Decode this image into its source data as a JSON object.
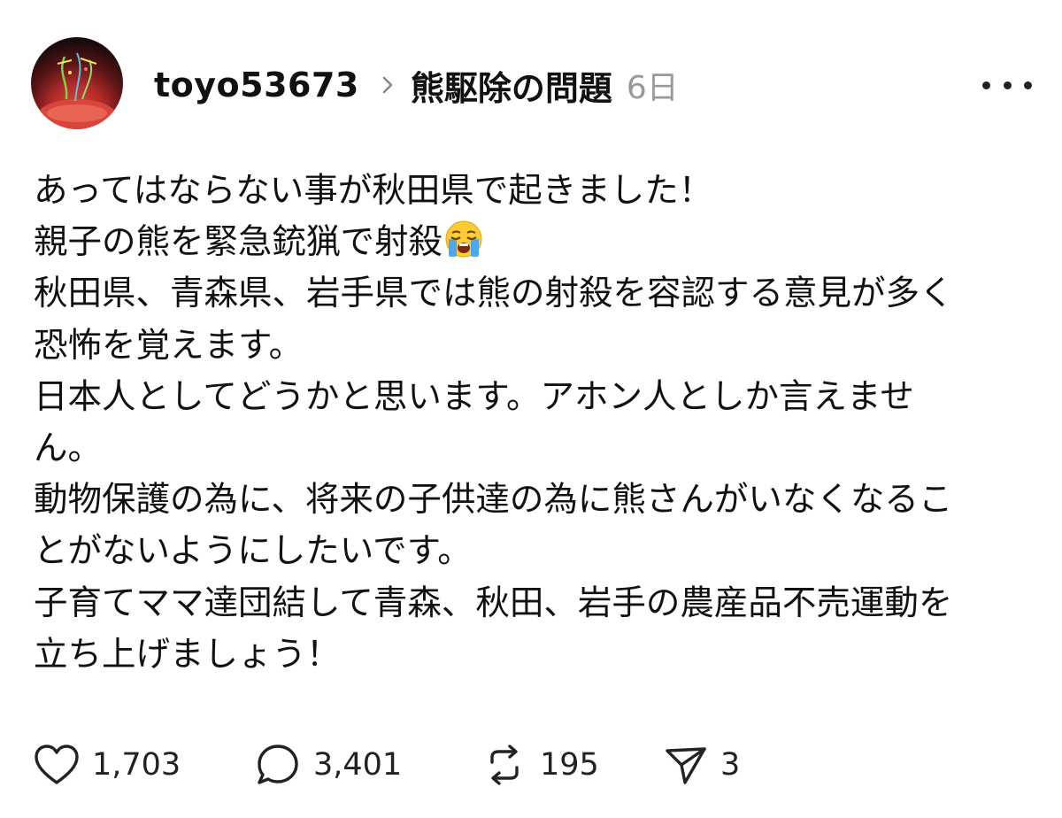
{
  "post": {
    "username": "toyo53673",
    "topic": "熊駆除の問題",
    "time": "6日",
    "body_lines": [
      "あってはならない事が秋田県で起きました！",
      "親子の熊を緊急銃猟で射殺",
      "秋田県、青森県、岩手県では熊の射殺を容認する意見が多く",
      "恐怖を覚えます。",
      "日本人としてどうかと思います。アホン人としか言えませ",
      "ん。",
      "動物保護の為に、将来の子供達の為に熊さんがいなくなるこ",
      "とがないようにしたいです。",
      "子育てママ達団結して青森、秋田、岩手の農産品不売運動を",
      "立ち上げましょう！"
    ],
    "emoji_after_line_2": "loudly-crying-face-emoji",
    "actions": {
      "likes": "1,703",
      "replies": "3,401",
      "reposts": "195",
      "shares": "3"
    }
  },
  "icons": {
    "avatar": "avatar",
    "chevron": "chevron-right-icon",
    "more": "more-horizontal-icon",
    "like": "heart-icon",
    "reply": "comment-bubble-icon",
    "repost": "repost-icon",
    "share": "send-icon"
  },
  "colors": {
    "text": "#111111",
    "muted": "#999999",
    "icon": "#222222"
  }
}
